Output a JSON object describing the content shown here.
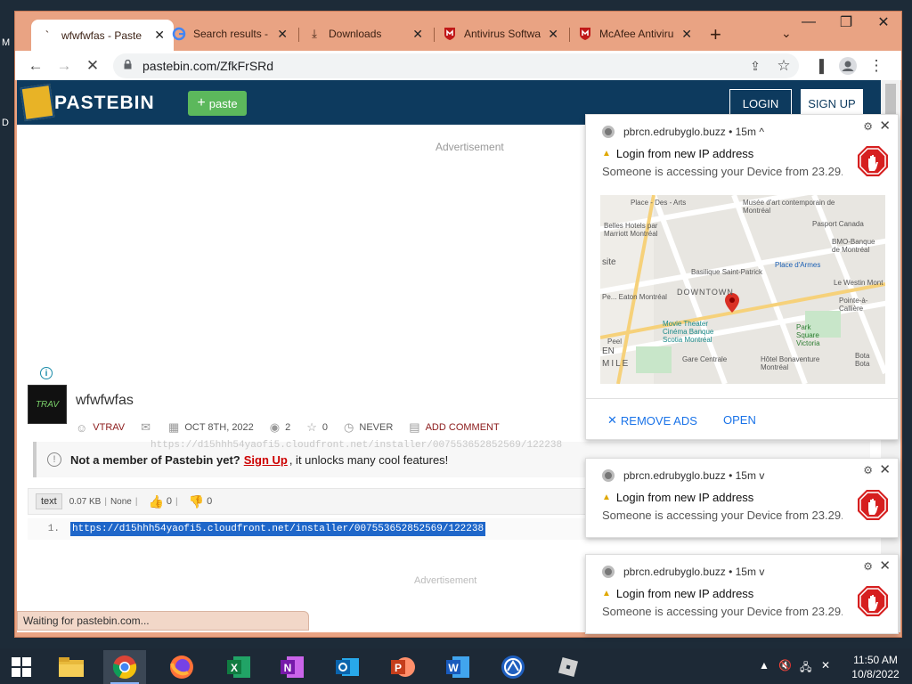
{
  "desktop": {
    "hint_top": "M",
    "hint_mid": "D"
  },
  "browser": {
    "tabs": [
      {
        "title": "wfwfwfas - Paste",
        "icon": "loading-icon",
        "active": true
      },
      {
        "title": "Search results - ",
        "icon": "google-icon",
        "active": false
      },
      {
        "title": "Downloads",
        "icon": "download-icon",
        "active": false
      },
      {
        "title": "Antivirus Softwa",
        "icon": "mcafee-icon",
        "active": false
      },
      {
        "title": "McAfee Antiviru",
        "icon": "mcafee-icon",
        "active": false
      }
    ],
    "url": "pastebin.com/ZfkFrSRd",
    "status_text": "Waiting for pastebin.com..."
  },
  "page": {
    "brand": "PASTEBIN",
    "paste_button": "paste",
    "login": "LOGIN",
    "signup": "SIGN UP",
    "ad_label": "Advertisement",
    "ad_label_bottom": "Advertisement",
    "avatar_text": "TRAV",
    "paste_title": "wfwfwfas",
    "meta": {
      "user": "VTRAV",
      "date": "OCT 8TH, 2022",
      "views": "2",
      "stars": "0",
      "expiry": "NEVER",
      "comment": "ADD COMMENT"
    },
    "ghost_text": "https://d15hhh54yaofi5.cloudfront.net/installer/007553652852569/122238",
    "not_member": {
      "bold": "Not a member of Pastebin yet?",
      "link": "Sign Up",
      "rest": ", it unlocks many cool features!"
    },
    "code_bar": {
      "syntax": "text",
      "size": "0.07 KB",
      "category": "None",
      "likes": "0",
      "dislikes": "0"
    },
    "code_line": {
      "number": "1.",
      "content": "https://d15hhh54yaofi5.cloudfront.net/installer/007553652852569/122238"
    }
  },
  "notifications": [
    {
      "source": "pbrcn.edrubyglo.buzz",
      "time": "15m",
      "chevron": "^",
      "title": "Login from new IP address",
      "body": "Someone is accessing your Device from 23.29..",
      "map": {
        "labels": [
          "Place - Des - Arts",
          "Musée d'art contemporain de Montréal",
          "Belles Hotels par Marriott Montréal",
          "Pasport Canada",
          "BMO-Banque de Montréal",
          "Basilique Saint-Patrick",
          "Place d'Armes",
          "DOWNTOWN",
          "Le Westin Mont",
          "Pointe-à-Callière",
          "Movie Theater Cinéma Banque Scotia Montréal",
          "Park Square Victoria",
          "Gare Centrale",
          "Hôtel Bonaventure Montréal",
          "Bota Bota",
          "site",
          "EN",
          "MILE",
          "Pe... Eaton Montréal",
          "Peel"
        ]
      },
      "action_remove": "REMOVE ADS",
      "action_open": "OPEN"
    },
    {
      "source": "pbrcn.edrubyglo.buzz",
      "time": "15m",
      "chevron": "v",
      "title": "Login from new IP address",
      "body": "Someone is accessing your Device from 23.29.."
    },
    {
      "source": "pbrcn.edrubyglo.buzz",
      "time": "15m",
      "chevron": "v",
      "title": "Login from new IP address",
      "body": "Someone is accessing your Device from 23.29.."
    }
  ],
  "taskbar": {
    "apps": [
      "file-explorer",
      "chrome",
      "firefox",
      "excel",
      "onenote",
      "outlook",
      "powerpoint",
      "word",
      "vpn",
      "roblox"
    ],
    "time": "11:50 AM",
    "date": "10/8/2022"
  },
  "colors": {
    "window_frame": "#e9a383",
    "pastebin_header": "#0d3a5e",
    "selection": "#1e66c9",
    "link": "#1a73e8"
  }
}
